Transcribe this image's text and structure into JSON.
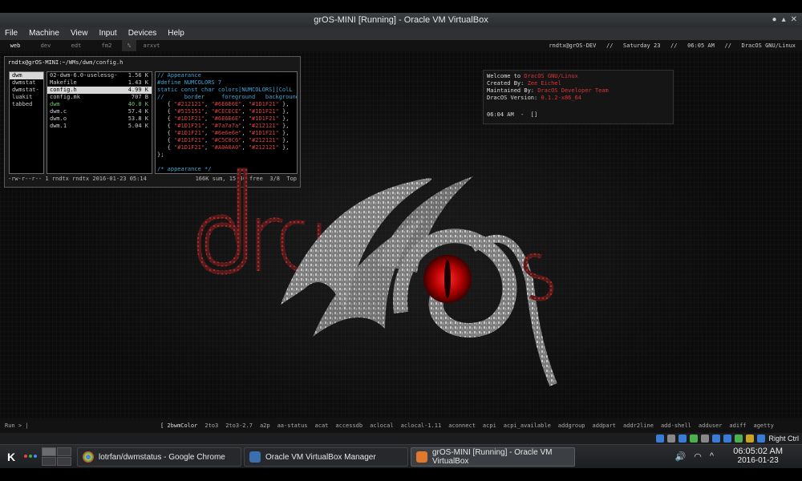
{
  "vbox": {
    "title": "grOS-MINI [Running] - Oracle VM VirtualBox",
    "menu": [
      "File",
      "Machine",
      "View",
      "Input",
      "Devices",
      "Help"
    ],
    "host_key": "Right Ctrl"
  },
  "dwm": {
    "tags": [
      "web",
      "dev",
      "edt",
      "fm2",
      "%",
      "arxvt"
    ],
    "status": "rndtx@grOS-DEV   //   Saturday 23   //   06:05 AM   //   DracOS GNU/Linux"
  },
  "terminal": {
    "path_host": "rndtx@grOS-MINI",
    "path_dir": ":~/WMs/dwm/config.h",
    "col1": [
      "dwm",
      "dwmstat",
      "dwmstat-",
      "luakit",
      "tabbed"
    ],
    "col2": [
      {
        "name": "02-dwm-6.0-uselessg-",
        "size": "1.56 K"
      },
      {
        "name": "Makefile",
        "size": "1.43 K"
      },
      {
        "name": "config.h",
        "size": "4.99 K"
      },
      {
        "name": "config.mk",
        "size": "707 B"
      },
      {
        "name": "dwm",
        "size": "40.0 K"
      },
      {
        "name": "dwm.c",
        "size": "57.4 K"
      },
      {
        "name": "dwm.o",
        "size": "53.8 K"
      },
      {
        "name": "dwm.1",
        "size": "5.04 K"
      }
    ],
    "preview": {
      "c1": "// Appearance",
      "c2": "#define NUMCOLORS 7",
      "c3": "static const char colors[NUMCOLORS][ColL",
      "c4": "//      border     foreground   background",
      "rows": [
        [
          "\"#212121\"",
          "\"#6E6E6E\"",
          "\"#1D1F21\""
        ],
        [
          "\"#515151\"",
          "\"#CECECE\"",
          "\"#1D1F21\""
        ],
        [
          "\"#1D1F21\"",
          "\"#6E6E6E\"",
          "\"#1D1F21\""
        ],
        [
          "\"#1D1F21\"",
          "\"#7a7a7a\"",
          "\"#212121\""
        ],
        [
          "\"#1D1F21\"",
          "\"#6e6e6e\"",
          "\"#1D1F21\""
        ],
        [
          "\"#1D1F21\"",
          "\"#C5C8C6\"",
          "\"#212121\""
        ],
        [
          "\"#1D1F21\"",
          "\"#A0A0A0\"",
          "\"#212121\""
        ]
      ],
      "end": "};",
      "c5": "/* appearance */"
    },
    "status_left": "-rw-r--r-- 1 rndtx rndtx 2016-01-23 05:14",
    "status_right": "166K sum, 15.8G free  3/8  Top"
  },
  "welcome": {
    "l1_pre": "Welcome to ",
    "l1_red": "DracOS GNU/Linux",
    "l2_pre": "Created By: ",
    "l2_red": "Zee Eichel",
    "l3_pre": "Maintained By: ",
    "l3_red": "DracOS Developer Team",
    "l4_pre": "DracOS Version: ",
    "l4_red": "0.1.2-x86_64",
    "prompt": "06:04 AM  -  []"
  },
  "run": {
    "label": "Run > |",
    "items": [
      "[  2bwmColor",
      "2to3",
      "2to3-2.7",
      "a2p",
      "aa-status",
      "acat",
      "accessdb",
      "aclocal",
      "aclocal-1.11",
      "aconnect",
      "acpi",
      "acpi_available",
      "addgroup",
      "addpart",
      "addr2line",
      "add-shell",
      "adduser",
      "adiff",
      "agetty"
    ]
  },
  "taskbar": {
    "tasks": [
      {
        "label": "lotrfan/dwmstatus - Google Chrome",
        "color": "#dd4b39"
      },
      {
        "label": "Oracle VM VirtualBox Manager",
        "color": "#3a6fb0"
      },
      {
        "label": "grOS-MINI [Running] - Oracle VM VirtualBox",
        "color": "#e0792b"
      }
    ],
    "time": "06:05:02 AM",
    "date": "2016-01-23"
  }
}
